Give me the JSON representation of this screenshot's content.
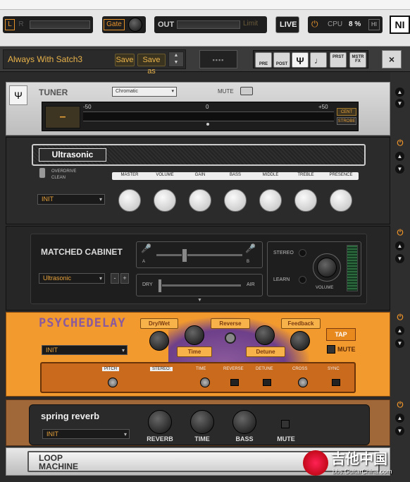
{
  "topbar": {
    "l": "L",
    "r": "R",
    "gate": "Gate",
    "out": "OUT",
    "limit": "Limit",
    "live": "LIVE",
    "cpu_label": "CPU",
    "cpu_value": "8 %",
    "hi": "HI",
    "logo": "NI"
  },
  "preset": {
    "name": "Always With Satch3",
    "save": "Save",
    "save_as": "Save as",
    "close": "×",
    "tools": [
      "PRE",
      "POST",
      "",
      "",
      "PRST",
      "MSTR FX"
    ]
  },
  "tuner": {
    "title": "TUNER",
    "mode": "Chromatic",
    "mute": "MUTE",
    "note": "–",
    "scale_min": "-50",
    "scale_mid": "0",
    "scale_max": "+50",
    "cent": "CENT",
    "strobe": "STROBE"
  },
  "amp": {
    "name": "Ultrasonic",
    "switch_top": "OVERDRIVE",
    "switch_bottom": "CLEAN",
    "preset": "INIT",
    "knobs": [
      "MASTER",
      "VOLUME",
      "GAIN",
      "BASS",
      "MIDDLE",
      "TREBLE",
      "PRESENCE"
    ]
  },
  "cabinet": {
    "title": "MATCHED CABINET",
    "cab": "Ultrasonic",
    "minus": "-",
    "plus": "+",
    "mic_a": "A",
    "mic_b": "B",
    "dry": "DRY",
    "air": "AIR",
    "stereo": "STEREO",
    "learn": "LEARN",
    "volume": "VOLUME"
  },
  "psychedelay": {
    "title": "PSYCHEDELAY",
    "preset": "INIT",
    "dry_wet": "Dry/Wet",
    "time": "Time",
    "reverse": "Reverse",
    "detune": "Detune",
    "feedback": "Feedback",
    "tap": "TAP",
    "mute": "MUTE",
    "sub": [
      "PITCH",
      "STEREO:",
      "TIME",
      "REVERSE",
      "DETUNE",
      "CROSS",
      "SYNC"
    ]
  },
  "spring": {
    "title": "spring reverb",
    "preset": "INIT",
    "knobs": [
      "REVERB",
      "TIME",
      "BASS"
    ],
    "mute": "MUTE"
  },
  "loop": {
    "line1": "LOOP",
    "line2": "MACHINE"
  },
  "watermark": {
    "cn": "吉他中国",
    "url": "bbs.GuitarChina.com"
  }
}
